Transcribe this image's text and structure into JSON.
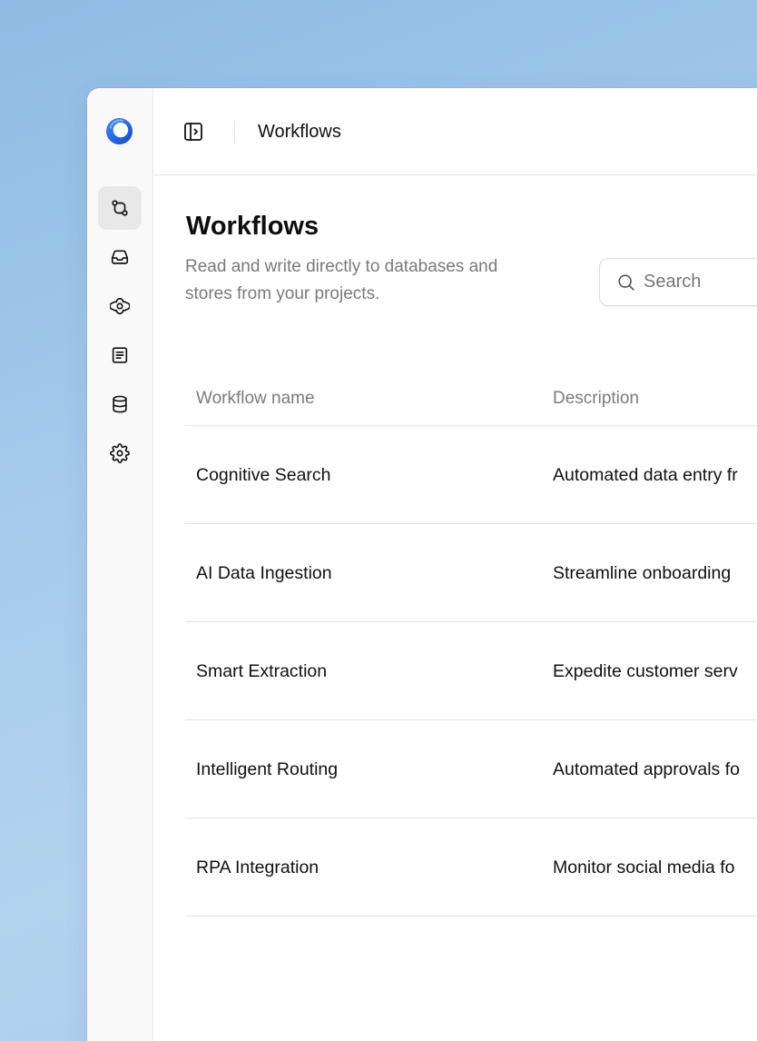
{
  "app": {
    "header_title": "Workflows"
  },
  "sidebar": {
    "items": [
      {
        "icon": "git-compare-icon",
        "active": true
      },
      {
        "icon": "inbox-icon",
        "active": false
      },
      {
        "icon": "ai-icon",
        "active": false
      },
      {
        "icon": "document-icon",
        "active": false
      },
      {
        "icon": "database-icon",
        "active": false
      },
      {
        "icon": "gear-icon",
        "active": false
      }
    ]
  },
  "page": {
    "title": "Workflows",
    "description": "Read and write directly to databases and stores from your projects."
  },
  "search": {
    "placeholder": "Search",
    "value": ""
  },
  "table": {
    "columns": [
      "Workflow name",
      "Description"
    ],
    "rows": [
      {
        "name": "Cognitive Search",
        "description": "Automated data entry fr"
      },
      {
        "name": "AI Data Ingestion",
        "description": "Streamline onboarding"
      },
      {
        "name": "Smart Extraction",
        "description": "Expedite customer serv"
      },
      {
        "name": "Intelligent Routing",
        "description": "Automated approvals fo"
      },
      {
        "name": "RPA Integration",
        "description": "Monitor social media fo"
      }
    ]
  },
  "colors": {
    "background": "#a6cbec",
    "logo_blue": "#2b6cf0",
    "active_nav": "#e8e8e8",
    "text_primary": "#111111",
    "text_muted": "#7a7a7a"
  }
}
